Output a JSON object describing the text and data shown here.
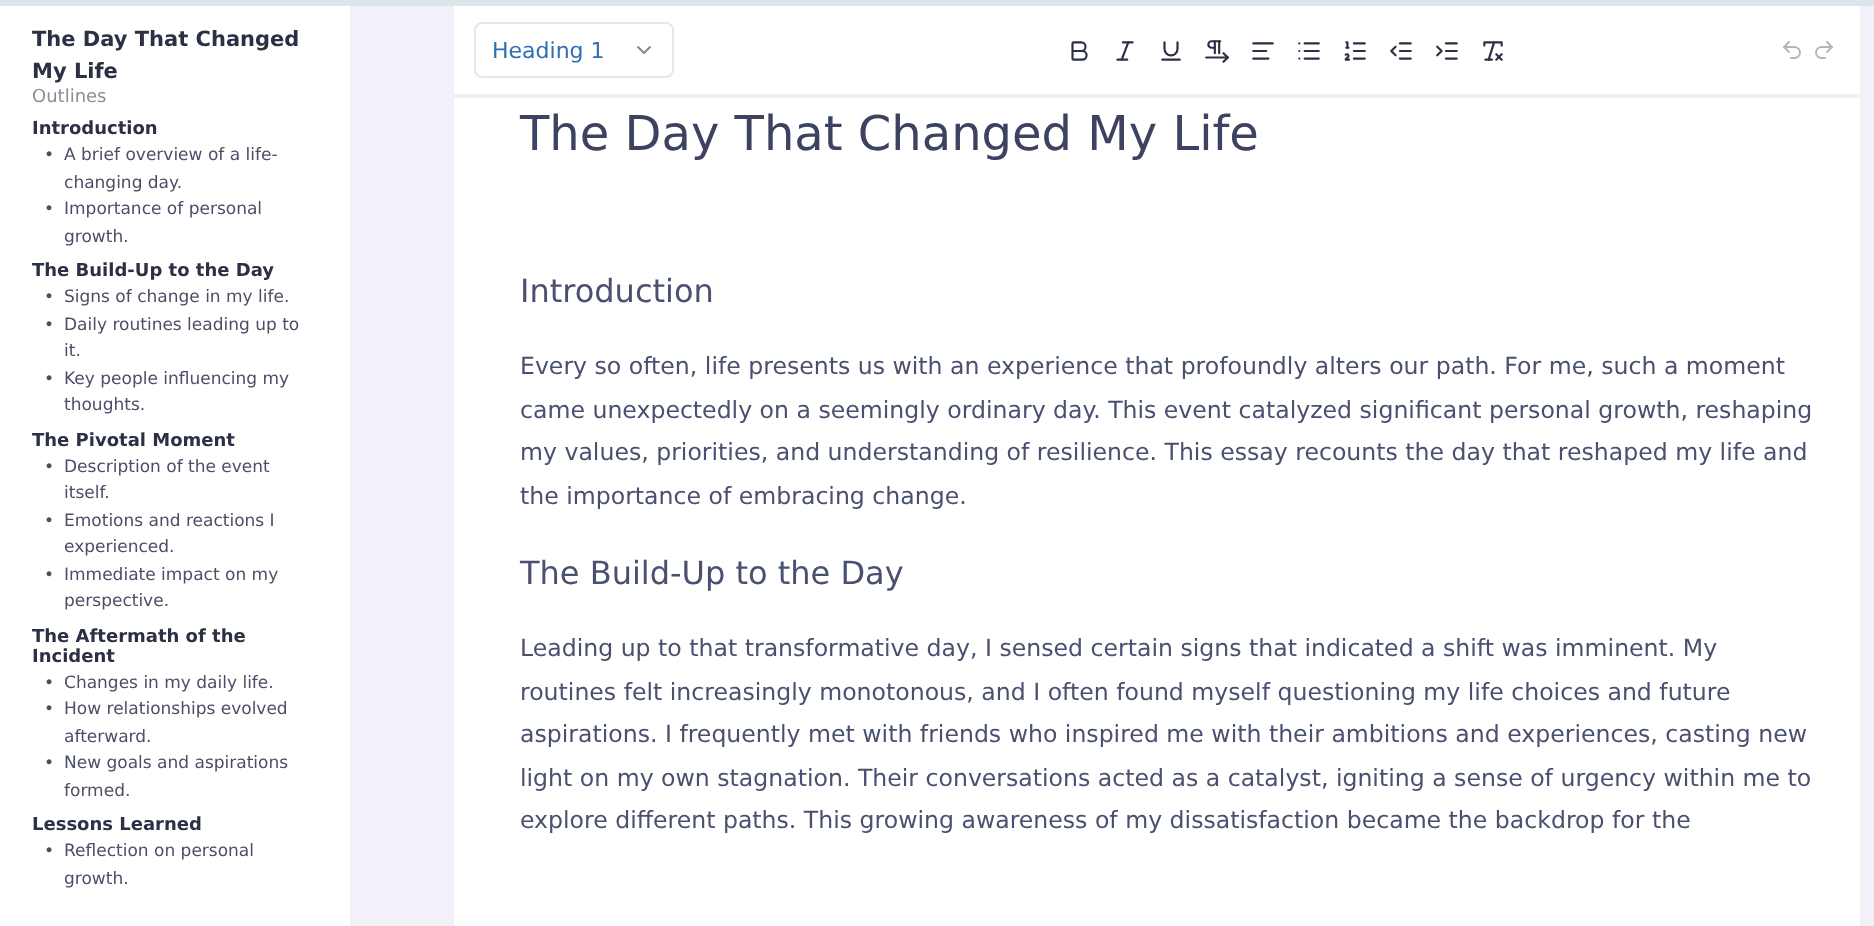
{
  "sidebar": {
    "title": "The Day That Changed My Life",
    "subtitle": "Outlines",
    "marker": "•",
    "sections": [
      {
        "heading": "Introduction",
        "items": [
          "A brief overview of a life-changing day.",
          "Importance of personal growth."
        ]
      },
      {
        "heading": "The Build-Up to the Day",
        "items": [
          "Signs of change in my life.",
          "Daily routines leading up to it.",
          "Key people influencing my thoughts."
        ]
      },
      {
        "heading": "The Pivotal Moment",
        "items": [
          "Description of the event itself.",
          "Emotions and reactions I experienced.",
          "Immediate impact on my perspective."
        ]
      },
      {
        "heading": "The Aftermath of the Incident",
        "items": [
          "Changes in my daily life.",
          "How relationships evolved afterward.",
          "New goals and aspirations formed."
        ]
      },
      {
        "heading": "Lessons Learned",
        "items": [
          "Reflection on personal growth."
        ]
      }
    ]
  },
  "toolbar": {
    "block_type": "Heading 1"
  },
  "document": [
    {
      "kind": "title",
      "text": "The Day That Changed My Life"
    },
    {
      "kind": "heading",
      "text": "Introduction"
    },
    {
      "kind": "paragraph",
      "text": "Every so often, life presents us with an experience that profoundly alters our path. For me, such a moment came unexpectedly on a seemingly ordinary day. This event catalyzed significant personal growth, reshaping my values, priorities, and understanding of resilience. This essay recounts the day that reshaped my life and the importance of embracing change."
    },
    {
      "kind": "heading",
      "text": "The Build-Up to the Day"
    },
    {
      "kind": "paragraph",
      "text": "Leading up to that transformative day, I sensed certain signs that indicated a shift was imminent. My routines felt increasingly monotonous, and I often found myself questioning my life choices and future aspirations. I frequently met with friends who inspired me with their ambitions and experiences, casting new light on my own stagnation. Their conversations acted as a catalyst, igniting a sense of urgency within me to explore different paths. This growing awareness of my dissatisfaction became the backdrop for the"
    }
  ]
}
